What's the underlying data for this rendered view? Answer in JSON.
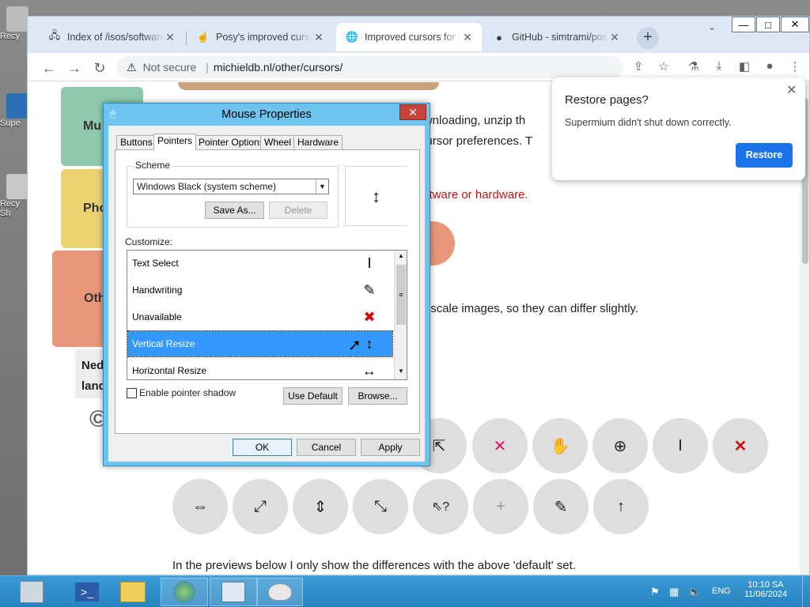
{
  "desktop": {
    "icons": [
      {
        "label": "Recy"
      },
      {
        "label": "Supe"
      },
      {
        "label": "Recy Sh"
      }
    ]
  },
  "browser": {
    "tabs": [
      {
        "title": "Index of /isos/software",
        "icon": "server-icon",
        "active": false
      },
      {
        "title": "Posy's improved cursors",
        "icon": "cursor-icon",
        "active": false
      },
      {
        "title": "Improved cursors for W",
        "icon": "globe-icon",
        "active": true
      },
      {
        "title": "GitHub - simtrami/posy",
        "icon": "github-icon",
        "active": false
      }
    ],
    "new_tab": "+",
    "address": {
      "security": "Not secure",
      "url": "michieldb.nl/other/cursors/"
    },
    "window_controls": {
      "minimize": "—",
      "maximize": "□",
      "close": "✕"
    }
  },
  "restore_popup": {
    "title": "Restore pages?",
    "message": "Supermium didn't shut down correctly.",
    "button": "Restore"
  },
  "page": {
    "cards": [
      {
        "label": "Mu",
        "color": "#8ec9ae"
      },
      {
        "label": "Pho",
        "color": "#ecd370"
      },
      {
        "label": "Oth",
        "color": "#e8977a"
      }
    ],
    "side_text": [
      "Ned",
      "land"
    ],
    "text_lines": [
      "r downloading, unzip th",
      "he cursor preferences. T",
      "o software or hardware.",
      "00% scale images, so they can differ slightly."
    ],
    "footer_text": "In the previews below I only show the differences with the above 'default' set.",
    "cursor_row1": [
      "⇱",
      "✕",
      "✋",
      "⊕",
      "I",
      "✕"
    ],
    "cursor_row2": [
      "⇔",
      "⤢",
      "⇕",
      "⤡",
      "⇖?",
      "+",
      "✎",
      "↑"
    ],
    "red_color": "#cc1111"
  },
  "dialog": {
    "title": "Mouse Properties",
    "tabs": [
      "Buttons",
      "Pointers",
      "Pointer Options",
      "Wheel",
      "Hardware"
    ],
    "active_tab": "Pointers",
    "scheme_label": "Scheme",
    "scheme_value": "Windows Black (system scheme)",
    "save_as": "Save As...",
    "delete": "Delete",
    "customize_label": "Customize:",
    "items": [
      {
        "name": "Text Select",
        "glyph": "I"
      },
      {
        "name": "Handwriting",
        "glyph": "✎"
      },
      {
        "name": "Unavailable",
        "glyph": "✖"
      },
      {
        "name": "Vertical Resize",
        "glyph": "↕"
      },
      {
        "name": "Horizontal Resize",
        "glyph": "↔"
      }
    ],
    "selected_item": "Vertical Resize",
    "shadow_label": "Enable pointer shadow",
    "use_default": "Use Default",
    "browse": "Browse...",
    "ok": "OK",
    "cancel": "Cancel",
    "apply": "Apply",
    "preview_glyph": "↕"
  },
  "taskbar": {
    "apps": [
      "server-manager-icon",
      "powershell-icon",
      "file-explorer-icon",
      "browser-icon",
      "control-panel-icon",
      "mouse-icon"
    ],
    "language": "ENG",
    "time": "10:10 SA",
    "date": "11/06/2024"
  }
}
